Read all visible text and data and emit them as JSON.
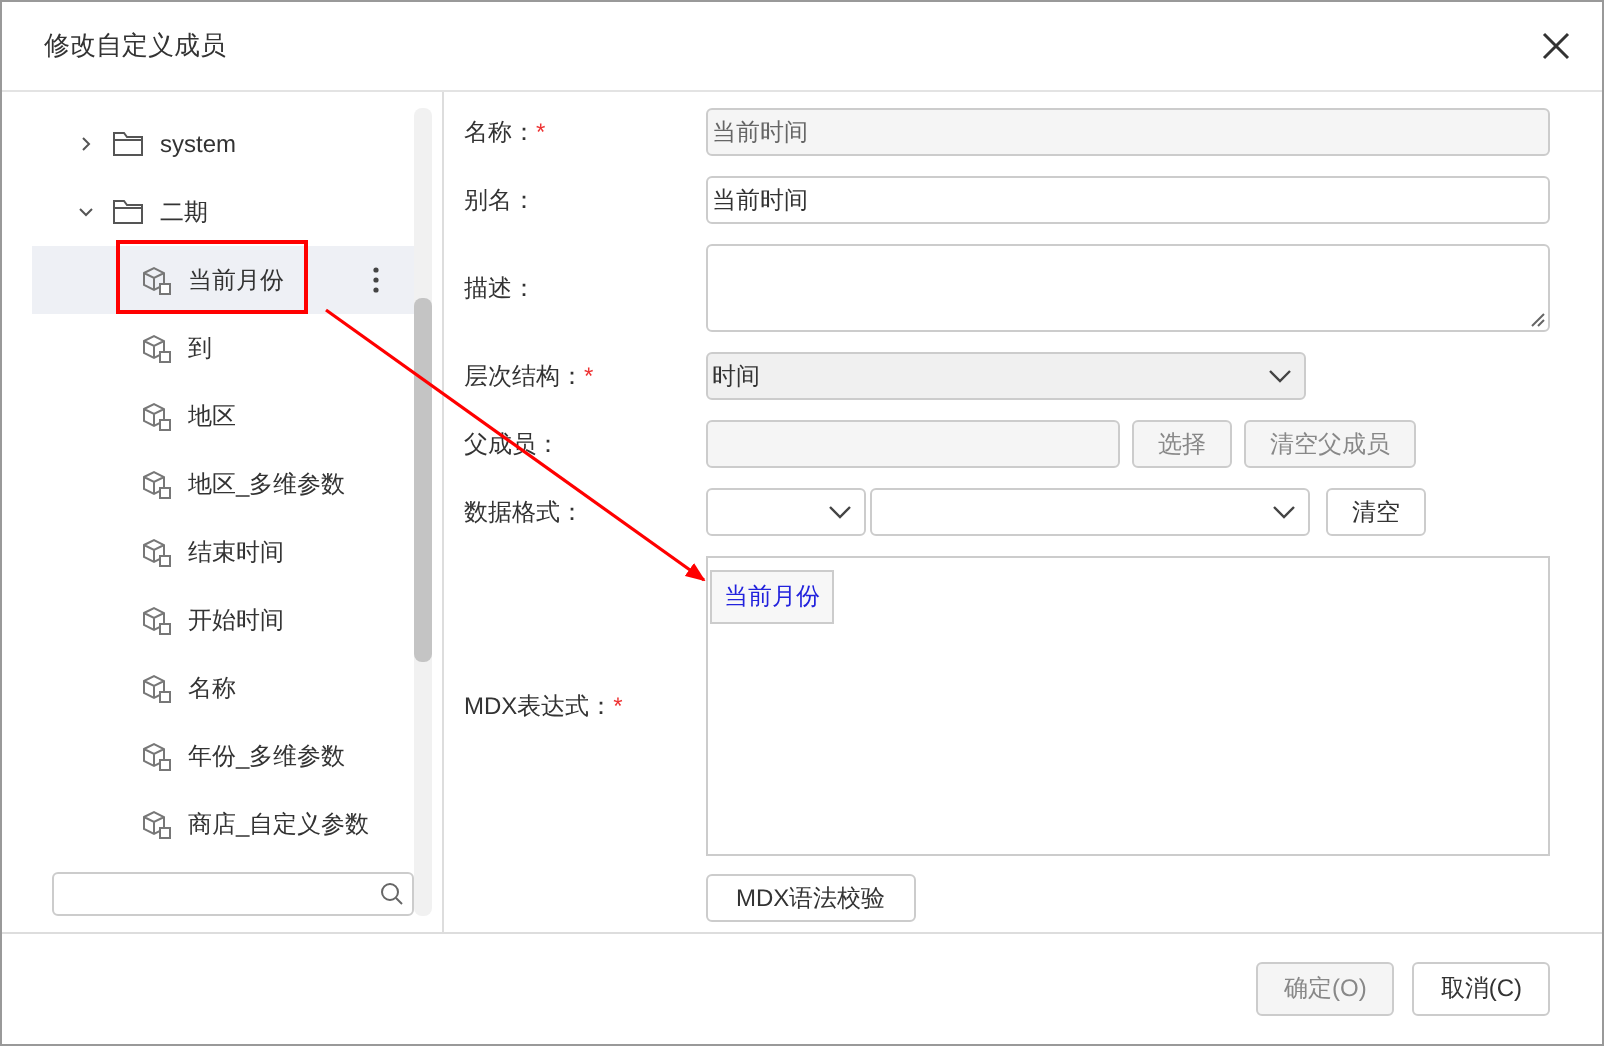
{
  "dialog": {
    "title": "修改自定义成员"
  },
  "tree": [
    {
      "kind": "folder",
      "label": "system",
      "expanded": false
    },
    {
      "kind": "folder",
      "label": "二期",
      "expanded": true,
      "children": [
        {
          "kind": "member",
          "label": "当前月份",
          "selected": true
        },
        {
          "kind": "member",
          "label": "到",
          "selected": false
        },
        {
          "kind": "member",
          "label": "地区",
          "selected": false
        },
        {
          "kind": "member",
          "label": "地区_多维参数",
          "selected": false
        },
        {
          "kind": "member",
          "label": "结束时间",
          "selected": false
        },
        {
          "kind": "member",
          "label": "开始时间",
          "selected": false
        },
        {
          "kind": "member",
          "label": "名称",
          "selected": false
        },
        {
          "kind": "member",
          "label": "年份_多维参数",
          "selected": false
        },
        {
          "kind": "member",
          "label": "商店_自定义参数",
          "selected": false
        }
      ]
    }
  ],
  "fields": [
    {
      "kind": "text",
      "label": "名称：",
      "required_mark": "*",
      "value": "当前时间",
      "disabled": true
    },
    {
      "kind": "text",
      "label": "别名：",
      "value": "当前时间",
      "disabled": false
    },
    {
      "kind": "textarea",
      "label": "描述："
    },
    {
      "kind": "select",
      "label": "层次结构：",
      "required_mark": "*",
      "value": "时间",
      "disabled": true
    },
    {
      "kind": "parent",
      "label": "父成员：",
      "disabled": true,
      "buttons": [
        "选择",
        "清空父成员"
      ]
    },
    {
      "kind": "format",
      "label": "数据格式：",
      "button": "清空"
    },
    {
      "kind": "mdx",
      "label": "MDX表达式：",
      "required_mark": "*",
      "chips": [
        "当前月份"
      ],
      "button": "MDX语法校验"
    }
  ],
  "footer": [
    {
      "label": "确定(O)",
      "disabled": true
    },
    {
      "label": "取消(C)",
      "disabled": false
    }
  ]
}
